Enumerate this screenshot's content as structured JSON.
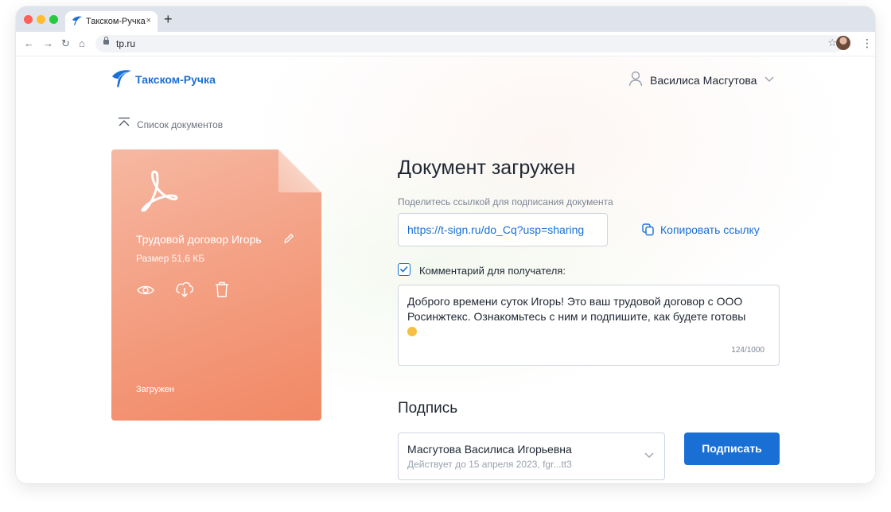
{
  "browser": {
    "tab_title": "Такском-Ручка",
    "tab_close": "×",
    "new_tab": "+",
    "url": "tp.ru",
    "nav": {
      "back": "←",
      "forward": "→",
      "reload": "↻",
      "home": "⌂"
    },
    "star": "☆",
    "menu": "⋮"
  },
  "header": {
    "brand": "Такском-Ручка",
    "user_name": "Василиса Масгутова"
  },
  "nav": {
    "back_label": "Список документов"
  },
  "file": {
    "name": "Трудовой договор Игорь",
    "size": "Размер 51,6 КБ",
    "status": "Загружен"
  },
  "main": {
    "title": "Документ загружен",
    "share_hint": "Поделитесь ссылкой для подписания документа",
    "share_link": "https://t-sign.ru/do_Cq?usp=sharing",
    "copy_label": "Копировать ссылку",
    "comment_checkbox_label": "Комментарий для получателя:",
    "comment_checked": true,
    "comment_text": "Доброго времени суток Игорь! Это ваш трудовой договор с ООО Росинжтекс. Ознакомьтесь с ним и подпишите, как будете готовы",
    "comment_counter": "124/1000",
    "signature_heading": "Подпись",
    "signer_name": "Масгутова Василиса Игорьевна",
    "signer_validity": "Действует до 15 апреля 2023, fgr...tt3",
    "sign_button": "Подписать"
  },
  "colors": {
    "accent": "#1a6fd4",
    "card_gradient_start": "#f6b8a2",
    "card_gradient_end": "#f18864"
  }
}
